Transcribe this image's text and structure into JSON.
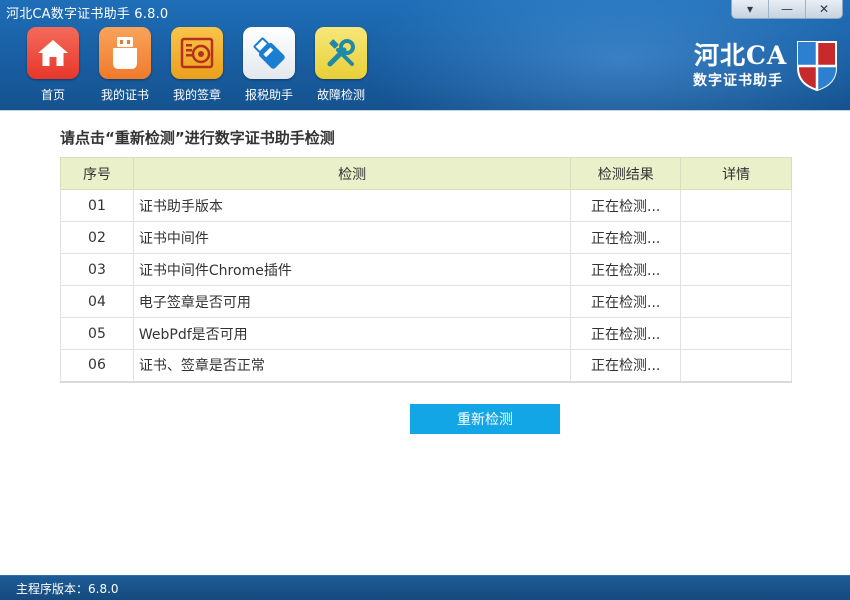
{
  "window": {
    "title": "河北CA数字证书助手  6.8.0",
    "controls": {
      "menu": "▾",
      "minimize": "—",
      "close": "✕"
    }
  },
  "toolbar": {
    "items": [
      {
        "label": "首页",
        "icon": "home-icon",
        "color": "#e8372b"
      },
      {
        "label": "我的证书",
        "icon": "usb-key-icon",
        "color": "#f07a2c"
      },
      {
        "label": "我的签章",
        "icon": "seal-icon",
        "color": "#eaa01c"
      },
      {
        "label": "报税助手",
        "icon": "usb-drive-icon",
        "color": "#e3e8ee"
      },
      {
        "label": "故障检测",
        "icon": "tools-icon",
        "color": "#e8cf38"
      }
    ]
  },
  "brand": {
    "line1": "河北CA",
    "line2": "数字证书助手"
  },
  "main": {
    "instruction": "请点击“重新检测”进行数字证书助手检测",
    "table": {
      "headers": [
        "序号",
        "检测",
        "检测结果",
        "详情"
      ],
      "rows": [
        {
          "num": "01",
          "name": "证书助手版本",
          "result": "正在检测...",
          "detail": ""
        },
        {
          "num": "02",
          "name": "证书中间件",
          "result": "正在检测...",
          "detail": ""
        },
        {
          "num": "03",
          "name": "证书中间件Chrome插件",
          "result": "正在检测...",
          "detail": ""
        },
        {
          "num": "04",
          "name": "电子签章是否可用",
          "result": "正在检测...",
          "detail": ""
        },
        {
          "num": "05",
          "name": "WebPdf是否可用",
          "result": "正在检测...",
          "detail": ""
        },
        {
          "num": "06",
          "name": "证书、签章是否正常",
          "result": "正在检测...",
          "detail": ""
        }
      ]
    },
    "recheck_label": "重新检测"
  },
  "statusbar": {
    "text": "主程序版本：6.8.0"
  },
  "colors": {
    "header": "#1a62a8",
    "accent_button": "#13a6e6",
    "table_header": "#e9f0ca"
  }
}
